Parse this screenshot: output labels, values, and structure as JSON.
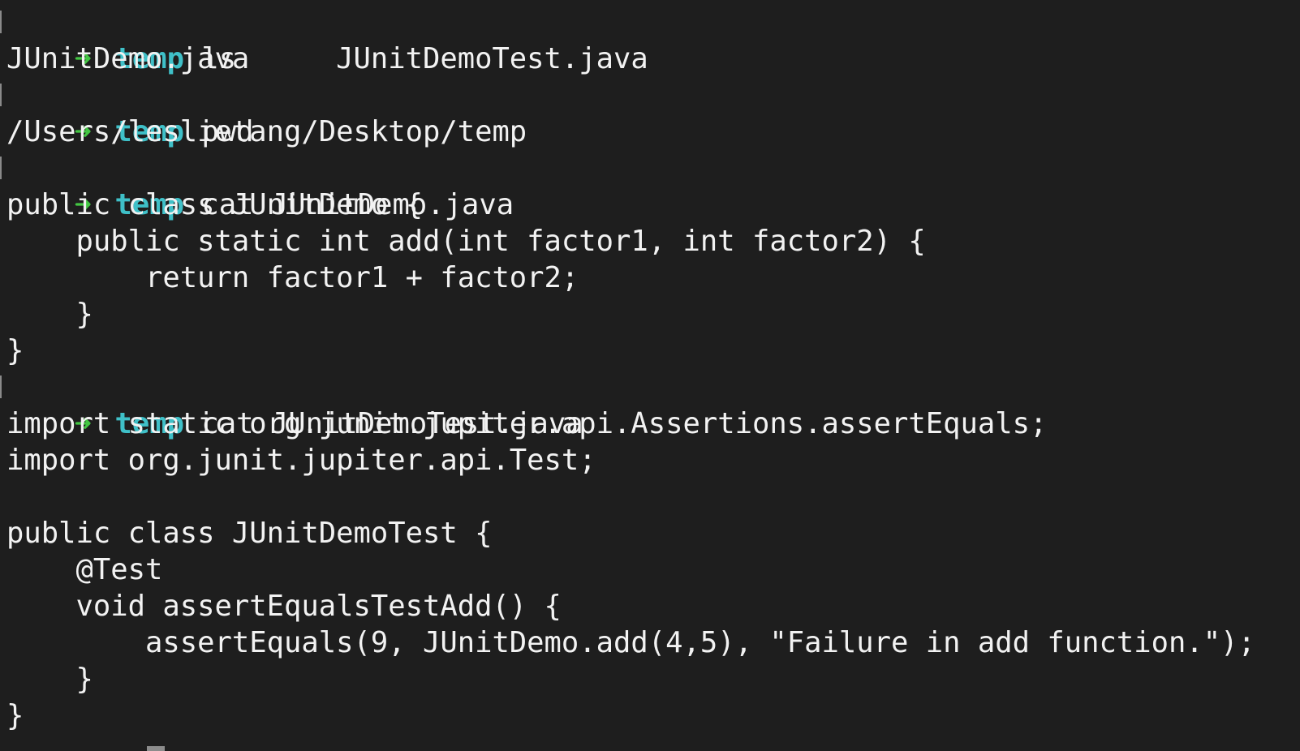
{
  "colors": {
    "background": "#1e1e1e",
    "text": "#f2f2f2",
    "prompt_arrow": "#43c643",
    "prompt_cwd": "#3fc0c8"
  },
  "prompt": {
    "arrow": "➜",
    "cwd": "temp"
  },
  "session": {
    "cmd1": {
      "command": " ls"
    },
    "ls_output": "JUnitDemo.java     JUnitDemoTest.java",
    "cmd2": {
      "command": " pwd"
    },
    "pwd_output": "/Users/leslietang/Desktop/temp",
    "cmd3": {
      "command": " cat JUnitDemo.java"
    },
    "file1": [
      "public class JUnitDemo {",
      "    public static int add(int factor1, int factor2) {",
      "        return factor1 + factor2;",
      "    }",
      "}"
    ],
    "cmd4": {
      "command": " cat JUnitDemoTest.java"
    },
    "file2": [
      "import static org.junit.jupiter.api.Assertions.assertEquals;",
      "import org.junit.jupiter.api.Test;",
      "",
      "public class JUnitDemoTest {",
      "    @Test",
      "    void assertEqualsTestAdd() {",
      "        assertEquals(9, JUnitDemo.add(4,5), \"Failure in add function.\");",
      "    }",
      "}"
    ]
  }
}
